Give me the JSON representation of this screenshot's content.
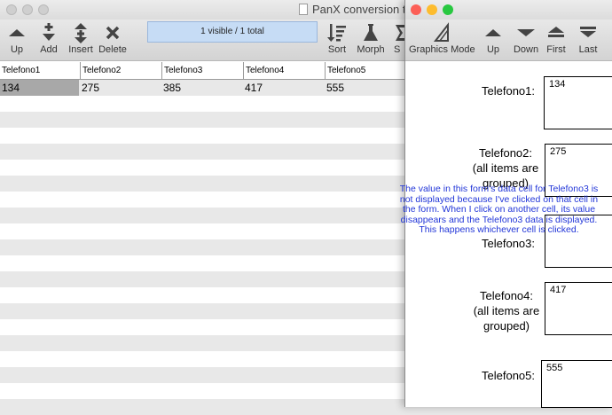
{
  "back_window": {
    "title": "PanX conversion te",
    "toolbar": {
      "up_label": "Up",
      "add_label": "Add",
      "insert_label": "Insert",
      "delete_label": "Delete",
      "status_text": "1 visible / 1 total",
      "sort_label": "Sort",
      "morph_label": "Morph",
      "partial_label": "S"
    },
    "columns": [
      "Telefono1",
      "Telefono2",
      "Telefono3",
      "Telefono4",
      "Telefono5"
    ],
    "rows": [
      [
        "134",
        "275",
        "385",
        "417",
        "555"
      ]
    ]
  },
  "form_window": {
    "toolbar": {
      "graphics_mode_label": "Graphics Mode",
      "up_label": "Up",
      "down_label": "Down",
      "first_label": "First",
      "last_label": "Last"
    },
    "fields": {
      "telefono1_label": "Telefono1:",
      "telefono1_value": "134",
      "telefono2_label": "Telefono2:",
      "telefono2_note": "(all items are grouped)",
      "telefono2_value": "275",
      "telefono3_label": "Telefono3:",
      "telefono3_value": "",
      "telefono4_label": "Telefono4:",
      "telefono4_note": "(all items are grouped)",
      "telefono4_value": "417",
      "telefono5_label": "Telefono5:",
      "telefono5_value": "555"
    }
  },
  "annotation": "The value in this form's data cell for Telefono3 is not displayed because I've clicked on that cell in the form.  When I click on another cell, its value disappears and the Telefono3 data is displayed.  This happens whichever cell is clicked.",
  "colors": {
    "annotation_text": "#2236d8",
    "status_box_bg": "#c6dcf5",
    "selected_cell": "#a8a8a8",
    "traffic_close": "#fc5f57",
    "traffic_min": "#fdbc2e",
    "traffic_max": "#28c840"
  }
}
